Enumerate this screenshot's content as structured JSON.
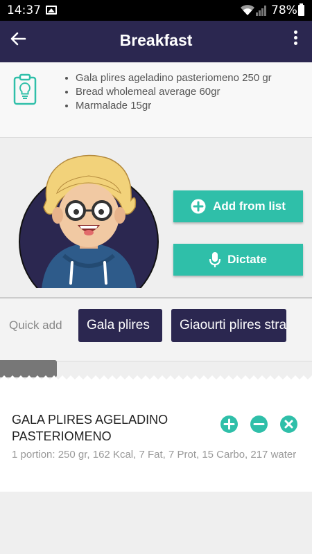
{
  "status_bar": {
    "time": "14:37",
    "battery": "78%"
  },
  "app_bar": {
    "title": "Breakfast"
  },
  "tips": {
    "items": [
      "Gala plires ageladino pasteriomeno 250 gr",
      "Bread wholemeal average 60gr",
      "Marmalade 15gr"
    ]
  },
  "actions": {
    "add_from_list": "Add from list",
    "dictate": "Dictate"
  },
  "quick_add": {
    "label": "Quick add",
    "chips": [
      "Gala plires",
      "Giaourti plires stra"
    ]
  },
  "food_item": {
    "name": "GALA PLIRES AGELADINO PASTERIOMENO",
    "details": "1 portion: 250 gr, 162 Kcal, 7 Fat, 7 Prot, 15 Carbo, 217 water"
  },
  "colors": {
    "header": "#2b2750",
    "accent": "#2fbfa9",
    "chip": "#2b2750"
  }
}
